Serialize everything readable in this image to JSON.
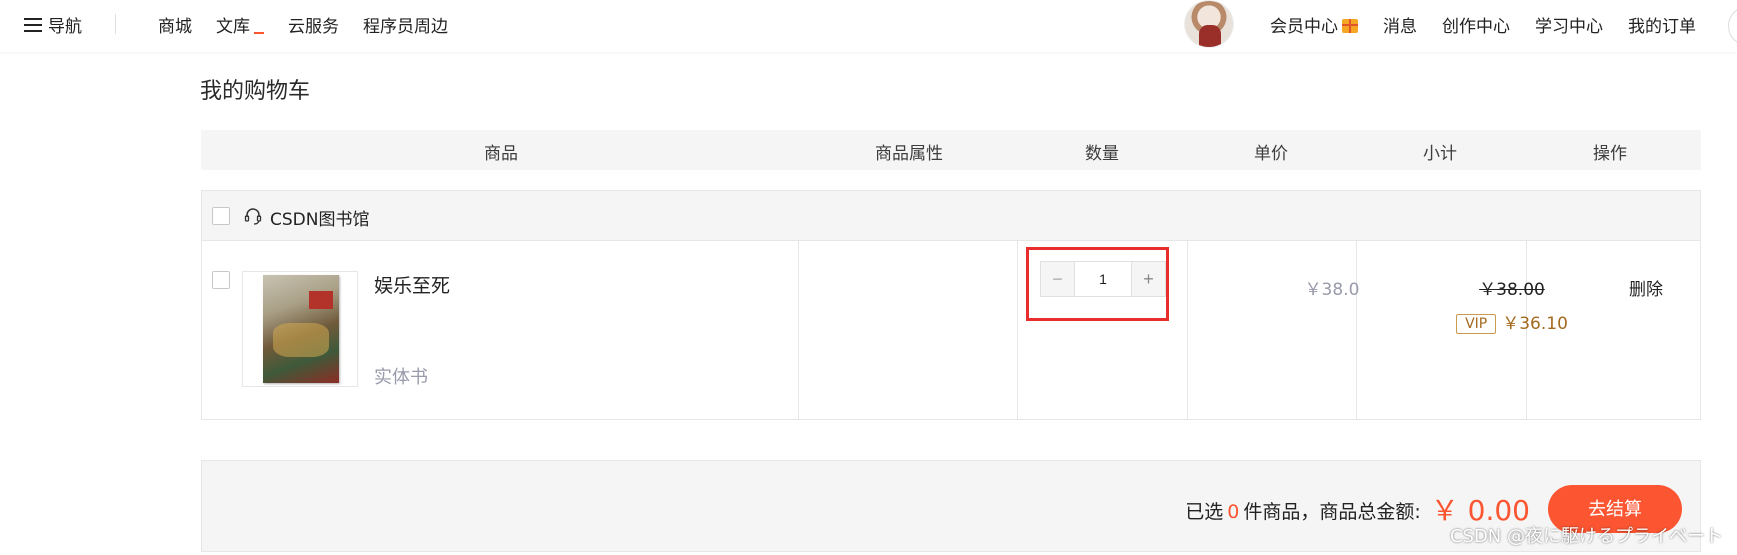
{
  "nav": {
    "menu_label": "导航",
    "links": [
      "商城",
      "文库",
      "云服务",
      "程序员周边"
    ],
    "right_links": [
      "会员中心",
      "消息",
      "创作中心",
      "学习中心",
      "我的订单"
    ]
  },
  "page_title": "我的购物车",
  "table_header": {
    "product": "商品",
    "attributes": "商品属性",
    "quantity": "数量",
    "unit_price": "单价",
    "subtotal": "小计",
    "operation": "操作"
  },
  "shop": {
    "name": "CSDN图书馆",
    "item": {
      "name": "娱乐至死",
      "type": "实体书",
      "quantity": "1",
      "minus": "−",
      "plus": "+",
      "unit_price": "￥38.0",
      "original_subtotal": "￥38.00",
      "vip_badge": "VIP",
      "vip_price": "￥36.10",
      "delete": "删除"
    }
  },
  "summary": {
    "prefix": "已选",
    "count": "0",
    "middle": "件商品，商品总金额:",
    "total": "￥ 0.00",
    "checkout": "去结算"
  },
  "watermark": "CSDN @夜に駆けるプライベート",
  "colors": {
    "accent": "#fc5531",
    "highlight": "#e82d2d",
    "vip": "#a46a1f"
  }
}
